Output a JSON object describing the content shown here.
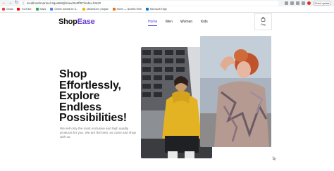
{
  "browser": {
    "url": "localhost/marinel-3qus5b0jh/raw/2e0ff07/index.html#",
    "update_label": "Finish update",
    "bookmarks": [
      {
        "label": "Gmail",
        "color": "#ea4335"
      },
      {
        "label": "YouTube",
        "color": "#ff0000"
      },
      {
        "label": "Maps",
        "color": "#34a853"
      },
      {
        "label": "Online tutorial for U...",
        "color": "#4285f4"
      },
      {
        "label": "MasterDev | Digital",
        "color": "#f4b400"
      },
      {
        "label": "Home — Nextflix Web",
        "color": "#e8710a"
      },
      {
        "label": "Microsoft Edge",
        "color": "#0078d4"
      }
    ]
  },
  "header": {
    "logo_main": "Shop",
    "logo_accent": "Ease",
    "nav": [
      "Home",
      "Men",
      "Women",
      "Kids"
    ],
    "active_nav": "Home",
    "cart_label": "Bag"
  },
  "hero": {
    "title_line1": "Shop",
    "title_line2": "Effortlessly,",
    "title_line3": "Explore",
    "title_line4": "Endless",
    "title_line5": "Possibilities!",
    "description": "We sell only the most exclusive and high quality products for you. We are the best, so come and shop with us."
  },
  "colors": {
    "accent": "#6b3fd6",
    "nav_active": "#4a3fd6",
    "text": "#111111",
    "muted": "#777777"
  }
}
